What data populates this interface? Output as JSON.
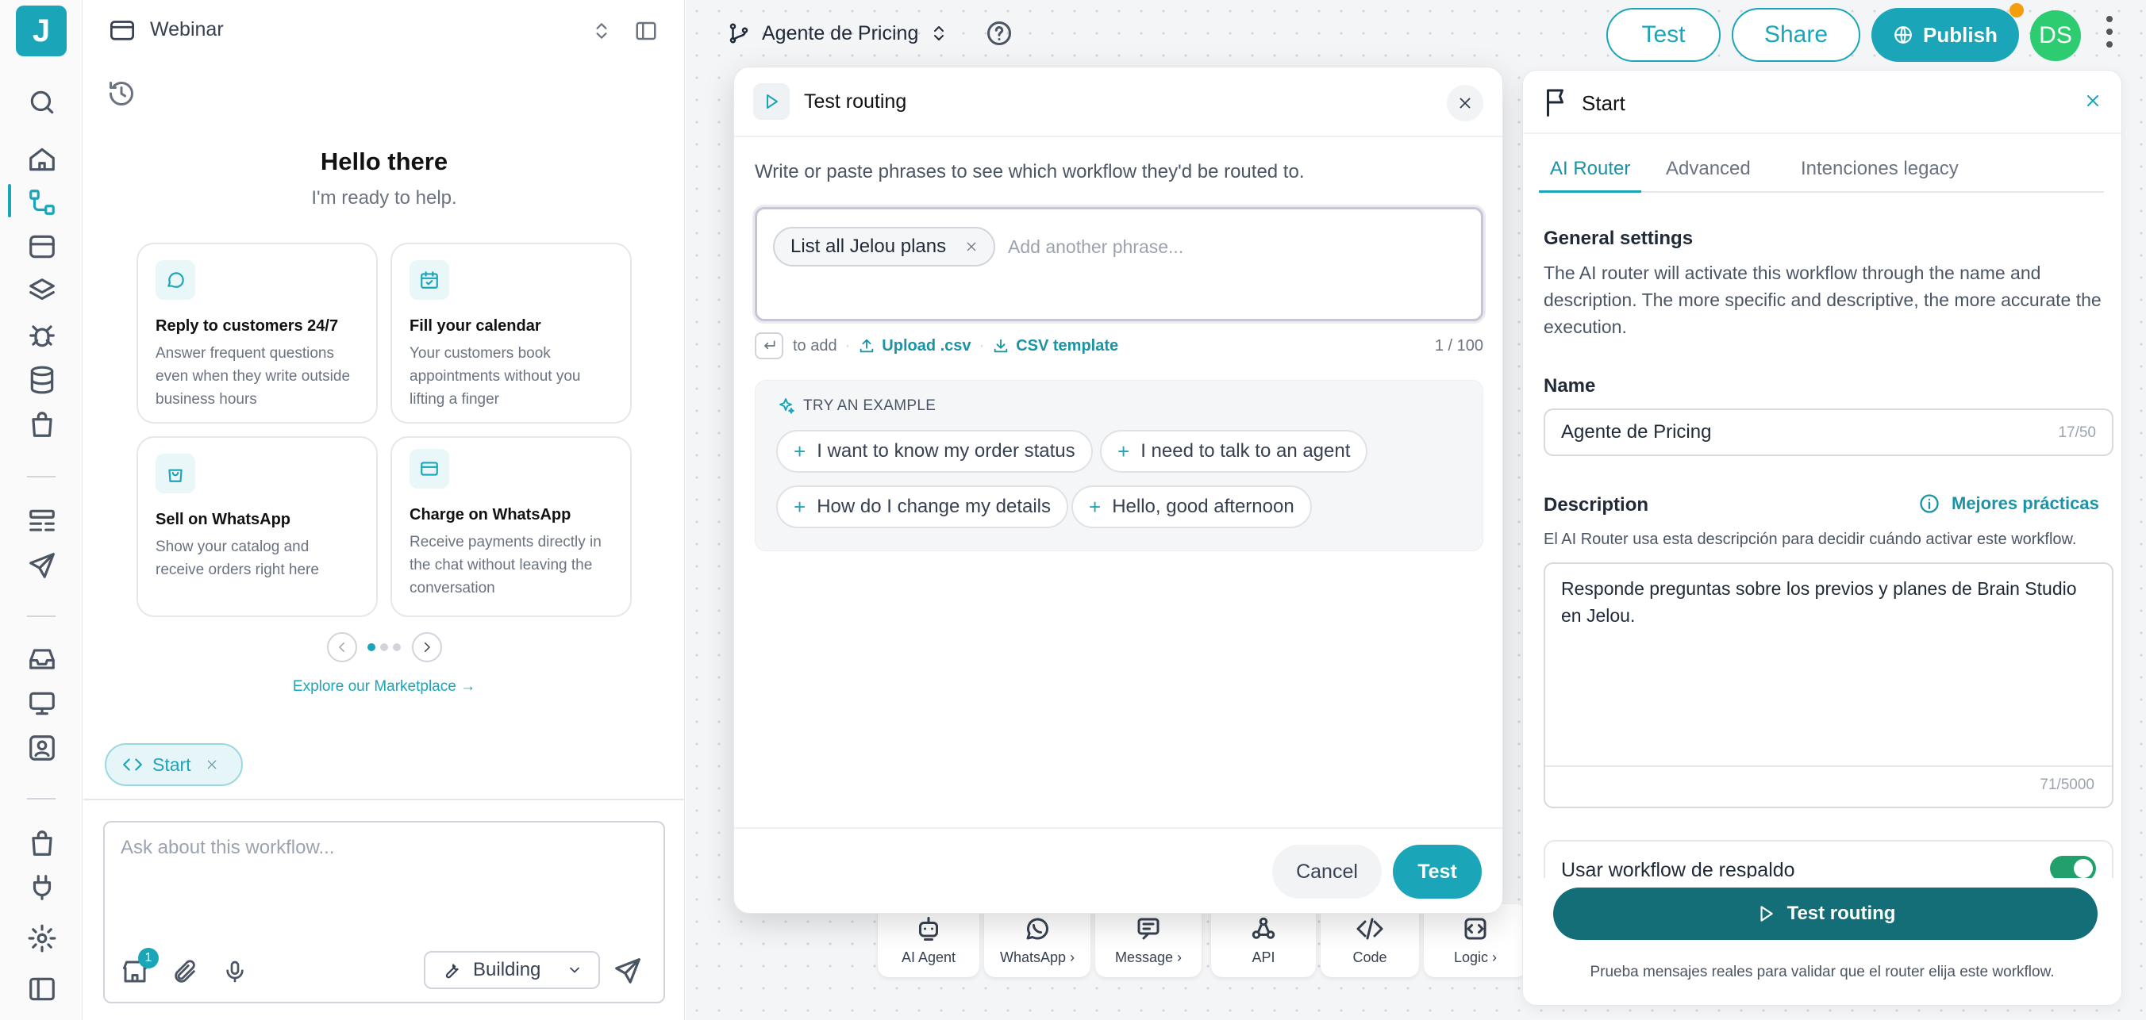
{
  "app": {
    "logo_letter": "J"
  },
  "chat": {
    "workspace": "Webinar",
    "greeting": "Hello there",
    "subgreeting": "I'm ready to help.",
    "cards": [
      {
        "title": "Reply to customers 24/7",
        "desc": "Answer frequent questions even when they write outside business hours",
        "icon": "chat-bubble-icon"
      },
      {
        "title": "Fill your calendar",
        "desc": "Your customers book appointments without you lifting a finger",
        "icon": "calendar-icon"
      },
      {
        "title": "Sell on WhatsApp",
        "desc": "Show your catalog and receive orders right here",
        "icon": "shopping-bag-icon"
      },
      {
        "title": "Charge on WhatsApp",
        "desc": "Receive payments directly in the chat without leaving the conversation",
        "icon": "credit-card-icon"
      }
    ],
    "carousel": {
      "pages": 3,
      "active": 1
    },
    "explore": "Explore our Marketplace →",
    "context_chip": "Start",
    "input_placeholder": "Ask about this workflow...",
    "badge_count": "1",
    "mode": "Building"
  },
  "topbar": {
    "workflow_name": "Agente de Pricing",
    "test": "Test",
    "share": "Share",
    "publish": "Publish",
    "avatar": "DS"
  },
  "toolbar": {
    "items": [
      {
        "label": "AI Agent",
        "icon": "ai-agent-icon"
      },
      {
        "label": "WhatsApp ›",
        "icon": "whatsapp-icon"
      },
      {
        "label": "Message ›",
        "icon": "message-icon"
      },
      {
        "label": "API",
        "icon": "api-icon"
      },
      {
        "label": "Code",
        "icon": "code-icon"
      },
      {
        "label": "Logic ›",
        "icon": "logic-icon"
      }
    ]
  },
  "modal": {
    "title": "Test routing",
    "instructions": "Write or paste phrases to see which workflow they'd be routed to.",
    "phrases": [
      "List all Jelou plans"
    ],
    "phrase_placeholder": "Add another phrase...",
    "to_add": "to add",
    "upload": "Upload .csv",
    "template": "CSV template",
    "counter": "1 / 100",
    "examples_label": "TRY AN EXAMPLE",
    "examples": [
      "I want to know my order status",
      "I need to talk to an agent",
      "How do I change my details",
      "Hello, good afternoon"
    ],
    "cancel": "Cancel",
    "test": "Test"
  },
  "right_panel": {
    "title": "Start",
    "tabs": [
      "AI Router",
      "Advanced",
      "Intenciones legacy"
    ],
    "active_tab": 0,
    "general_settings": "General settings",
    "general_desc": "The AI router will activate this workflow through the name and description. The more specific and descriptive, the more accurate the execution.",
    "name_label": "Name",
    "name_value": "Agente de Pricing",
    "name_count": "17/50",
    "description_label": "Description",
    "best_practices": "Mejores prácticas",
    "description_hint": "El AI Router usa esta descripción para decidir cuándo activar este workflow.",
    "description_value": "Responde preguntas sobre los previos y planes de Brain Studio en Jelou.",
    "description_count": "71/5000",
    "fallback_label": "Usar workflow de respaldo",
    "fallback_enabled": true,
    "test_routing": "Test routing",
    "footer_hint": "Prueba mensajes reales para validar que el router elija este workflow."
  },
  "colors": {
    "accent": "#1ba5b8",
    "dark_accent": "#136e78",
    "toggle_on": "#22a06b",
    "avatar": "#2ecc71"
  }
}
